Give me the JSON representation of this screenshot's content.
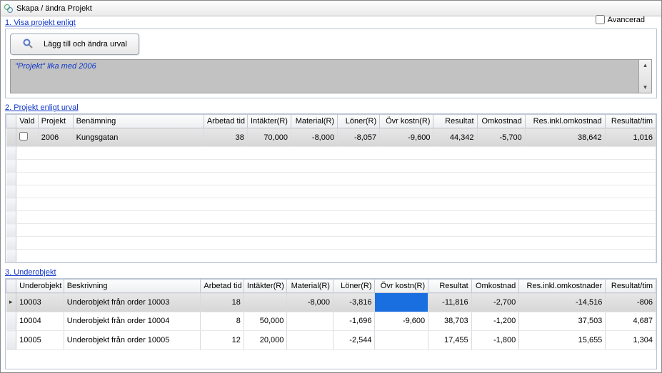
{
  "window": {
    "title": "Skapa / ändra Projekt"
  },
  "section1": {
    "label": "1. Visa projekt enligt",
    "add_button": "Lägg till och ändra urval",
    "advanced_label": "Avancerad",
    "filter_text": "\"Projekt\" lika med 2006"
  },
  "section2": {
    "label": "2. Projekt enligt urval",
    "columns": {
      "vald": "Vald",
      "projekt": "Projekt",
      "benamning": "Benämning",
      "arbetad": "Arbetad tid",
      "intakter": "Intäkter(R)",
      "material": "Material(R)",
      "loner": "Löner(R)",
      "ovr": "Övr kostn(R)",
      "resultat": "Resultat",
      "omkostnad": "Omkostnad",
      "resinkl": "Res.inkl.omkostnad",
      "restim": "Resultat/tim"
    },
    "rows": [
      {
        "projekt": "2006",
        "benamning": "Kungsgatan",
        "arbetad": "38",
        "intakter": "70,000",
        "material": "-8,000",
        "loner": "-8,057",
        "ovr": "-9,600",
        "resultat": "44,342",
        "omkostnad": "-5,700",
        "resinkl": "38,642",
        "restim": "1,016"
      }
    ]
  },
  "section3": {
    "label": "3. Underobjekt",
    "columns": {
      "under": "Underobjekt",
      "beskr": "Beskrivning",
      "arbetad": "Arbetad tid",
      "intakter": "Intäkter(R)",
      "material": "Material(R)",
      "loner": "Löner(R)",
      "ovr": "Övr kostn(R)",
      "resultat": "Resultat",
      "omkostnad": "Omkostnad",
      "resinkl": "Res.inkl.omkostnader",
      "restim": "Resultat/tim"
    },
    "rows": [
      {
        "under": "10003",
        "beskr": "Underobjekt från order 10003",
        "arbetad": "18",
        "intakter": "",
        "material": "-8,000",
        "loner": "-3,816",
        "ovr": "",
        "resultat": "-11,816",
        "omkostnad": "-2,700",
        "resinkl": "-14,516",
        "restim": "-806",
        "selected": true
      },
      {
        "under": "10004",
        "beskr": "Underobjekt från order 10004",
        "arbetad": "8",
        "intakter": "50,000",
        "material": "",
        "loner": "-1,696",
        "ovr": "-9,600",
        "resultat": "38,703",
        "omkostnad": "-1,200",
        "resinkl": "37,503",
        "restim": "4,687"
      },
      {
        "under": "10005",
        "beskr": "Underobjekt från order 10005",
        "arbetad": "12",
        "intakter": "20,000",
        "material": "",
        "loner": "-2,544",
        "ovr": "",
        "resultat": "17,455",
        "omkostnad": "-1,800",
        "resinkl": "15,655",
        "restim": "1,304"
      }
    ]
  }
}
